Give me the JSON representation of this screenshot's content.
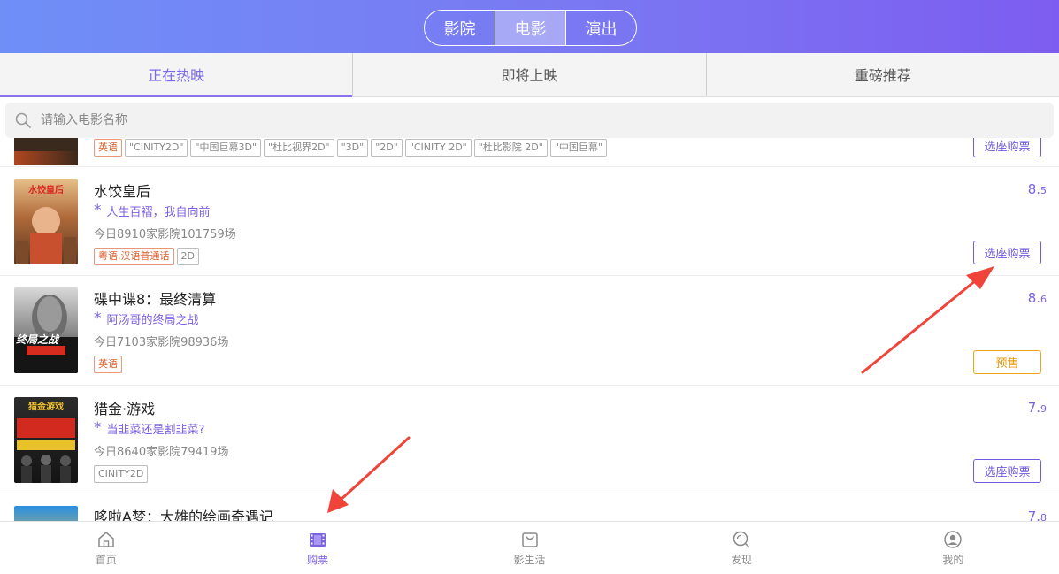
{
  "header": {
    "segments": [
      "影院",
      "电影",
      "演出"
    ],
    "active_segment": "电影"
  },
  "tabs": [
    "正在热映",
    "即将上映",
    "重磅推荐"
  ],
  "search": {
    "placeholder": "请输入电影名称"
  },
  "movies": [
    {
      "title": "",
      "tags": [
        "英语",
        "\"CINITY2D\"",
        "\"中国巨幕3D\"",
        "\"杜比视界2D\"",
        "\"3D\"",
        "\"2D\"",
        "\"CINITY 2D\"",
        "\"杜比影院 2D\"",
        "\"中国巨幕\""
      ],
      "button": "选座购票"
    },
    {
      "title": "水饺皇后",
      "slogan": "人生百褶，我自向前",
      "stats": "今日8910家影院101759场",
      "tags": [
        "粤语,汉语普通话",
        "2D"
      ],
      "score_int": "8.",
      "score_dec": "5",
      "button": "选座购票",
      "poster_text": "水饺皇后"
    },
    {
      "title": "碟中谍8：最终清算",
      "slogan": "阿汤哥的终局之战",
      "stats": "今日7103家影院98936场",
      "tags": [
        "英语"
      ],
      "score_int": "8.",
      "score_dec": "6",
      "button": "预售",
      "poster_text": "终局之战"
    },
    {
      "title": "猎金·游戏",
      "slogan": "当韭菜还是割韭菜?",
      "stats": "今日8640家影院79419场",
      "tags": [
        "CINITY2D"
      ],
      "score_int": "7.",
      "score_dec": "9",
      "button": "选座购票",
      "poster_text": "猎金游戏"
    },
    {
      "title": "哆啦A梦：大雄的绘画奇遇记",
      "score_int": "7.",
      "score_dec": "8"
    }
  ],
  "bottom_nav": [
    {
      "label": "首页",
      "icon": "home-icon"
    },
    {
      "label": "购票",
      "icon": "film-icon"
    },
    {
      "label": "影生活",
      "icon": "bag-icon"
    },
    {
      "label": "发现",
      "icon": "discover-icon"
    },
    {
      "label": "我的",
      "icon": "user-icon"
    }
  ],
  "colors": {
    "accent": "#7b62e3",
    "presale": "#e89a0b",
    "language_tag": "#e0602d",
    "annotation_arrow": "#f0443a"
  }
}
